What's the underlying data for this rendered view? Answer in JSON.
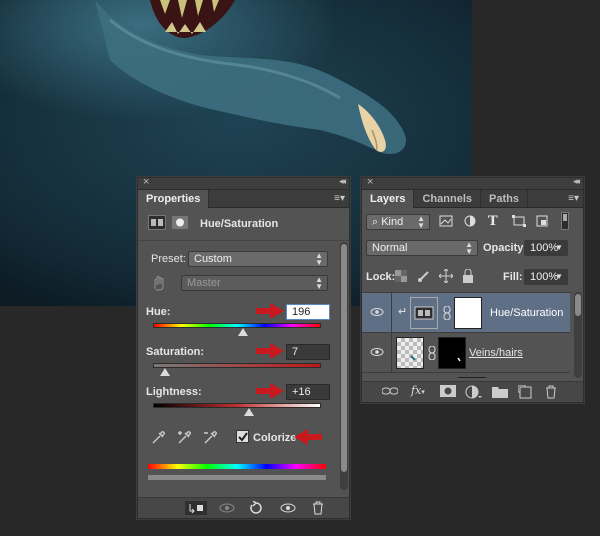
{
  "properties": {
    "tab_label": "Properties",
    "adjustment_title": "Hue/Saturation",
    "preset_label": "Preset:",
    "preset_value": "Custom",
    "channel_value": "Master",
    "hue_label": "Hue:",
    "hue_value": "196",
    "saturation_label": "Saturation:",
    "saturation_value": "7",
    "lightness_label": "Lightness:",
    "lightness_value": "+16",
    "colorize_label": "Colorize",
    "colorize_checked": true,
    "slider_levels": {
      "hue": 0.5,
      "saturation": 0.05,
      "lightness": 0.54
    },
    "accent_arrow_color": "#c8191e"
  },
  "layers": {
    "tabs": [
      "Layers",
      "Channels",
      "Paths"
    ],
    "kind_label": "Kind",
    "blend_mode": "Normal",
    "opacity_label": "Opacity:",
    "opacity_value": "100%",
    "lock_label": "Lock:",
    "fill_label": "Fill:",
    "fill_value": "100%",
    "items": [
      {
        "name": "Hue/Saturation",
        "selected": true
      },
      {
        "name": "Veins/hairs",
        "selected": false
      }
    ],
    "selected_color": "#5f6f86"
  }
}
